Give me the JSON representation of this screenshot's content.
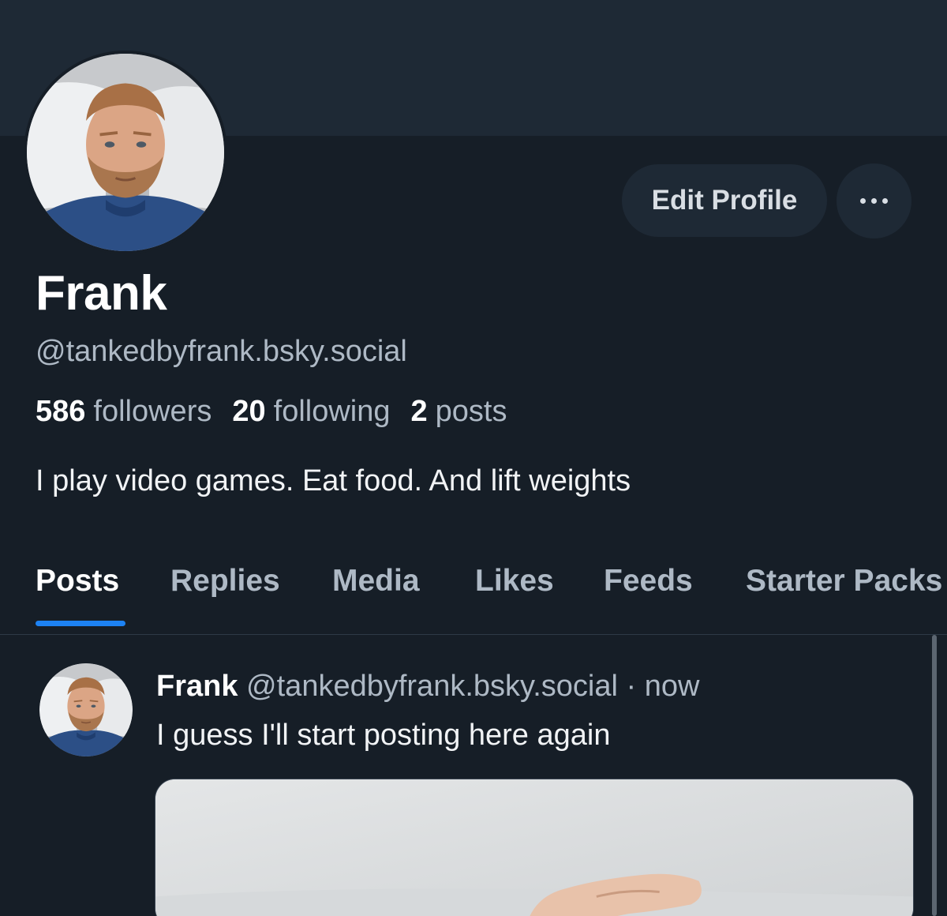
{
  "profile": {
    "display_name": "Frank",
    "handle": "@tankedbyfrank.bsky.social",
    "stats": {
      "followers_count": "586",
      "followers_label": "followers",
      "following_count": "20",
      "following_label": "following",
      "posts_count": "2",
      "posts_label": "posts"
    },
    "bio": "I play video games. Eat food. And lift weights"
  },
  "actions": {
    "edit_profile_label": "Edit Profile",
    "more_icon": "more-horizontal-icon"
  },
  "tabs": [
    {
      "label": "Posts",
      "active": true
    },
    {
      "label": "Replies",
      "active": false
    },
    {
      "label": "Media",
      "active": false
    },
    {
      "label": "Likes",
      "active": false
    },
    {
      "label": "Feeds",
      "active": false
    },
    {
      "label": "Starter Packs",
      "active": false
    }
  ],
  "post": {
    "author": "Frank",
    "handle": "@tankedbyfrank.bsky.social",
    "separator": "·",
    "time": "now",
    "text": "I guess I'll start posting here again"
  },
  "colors": {
    "background": "#161e27",
    "banner": "#1e2935",
    "button_bg": "#1e2935",
    "muted_text": "#aeb9c5",
    "accent": "#1d82f3"
  }
}
